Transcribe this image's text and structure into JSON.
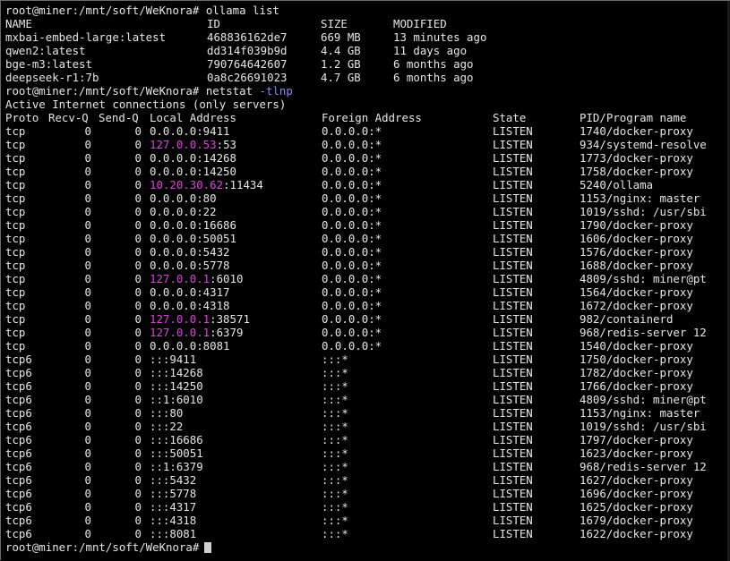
{
  "prompt": "root@miner:/mnt/soft/WeKnora#",
  "commands": {
    "ollama": "ollama list",
    "netstat_cmd": "netstat",
    "netstat_opt": "-tlnp"
  },
  "ollama": {
    "headers": [
      "NAME",
      "ID",
      "SIZE",
      "MODIFIED"
    ],
    "rows": [
      [
        "mxbai-embed-large:latest",
        "468836162de7",
        "669 MB",
        "13 minutes ago"
      ],
      [
        "qwen2:latest",
        "dd314f039b9d",
        "4.4 GB",
        "11 days ago"
      ],
      [
        "bge-m3:latest",
        "790764642607",
        "1.2 GB",
        "6 months ago"
      ],
      [
        "deepseek-r1:7b",
        "0a8c26691023",
        "4.7 GB",
        "6 months ago"
      ]
    ]
  },
  "netstat": {
    "banner": "Active Internet connections (only servers)",
    "headers": [
      "Proto",
      "Recv-Q",
      "Send-Q",
      "Local Address",
      "Foreign Address",
      "State",
      "PID/Program name"
    ],
    "rows": [
      [
        "tcp",
        "0",
        "0",
        "",
        "0.0.0.0:9411",
        "0.0.0.0:*",
        "LISTEN",
        "1740/docker-proxy"
      ],
      [
        "tcp",
        "0",
        "0",
        "127.0.0.53",
        ":53",
        "0.0.0.0:*",
        "LISTEN",
        "934/systemd-resolve"
      ],
      [
        "tcp",
        "0",
        "0",
        "",
        "0.0.0.0:14268",
        "0.0.0.0:*",
        "LISTEN",
        "1773/docker-proxy"
      ],
      [
        "tcp",
        "0",
        "0",
        "",
        "0.0.0.0:14250",
        "0.0.0.0:*",
        "LISTEN",
        "1758/docker-proxy"
      ],
      [
        "tcp",
        "0",
        "0",
        "10.20.30.62",
        ":11434",
        "0.0.0.0:*",
        "LISTEN",
        "5240/ollama"
      ],
      [
        "tcp",
        "0",
        "0",
        "",
        "0.0.0.0:80",
        "0.0.0.0:*",
        "LISTEN",
        "1153/nginx: master"
      ],
      [
        "tcp",
        "0",
        "0",
        "",
        "0.0.0.0:22",
        "0.0.0.0:*",
        "LISTEN",
        "1019/sshd: /usr/sbi"
      ],
      [
        "tcp",
        "0",
        "0",
        "",
        "0.0.0.0:16686",
        "0.0.0.0:*",
        "LISTEN",
        "1790/docker-proxy"
      ],
      [
        "tcp",
        "0",
        "0",
        "",
        "0.0.0.0:50051",
        "0.0.0.0:*",
        "LISTEN",
        "1606/docker-proxy"
      ],
      [
        "tcp",
        "0",
        "0",
        "",
        "0.0.0.0:5432",
        "0.0.0.0:*",
        "LISTEN",
        "1576/docker-proxy"
      ],
      [
        "tcp",
        "0",
        "0",
        "",
        "0.0.0.0:5778",
        "0.0.0.0:*",
        "LISTEN",
        "1688/docker-proxy"
      ],
      [
        "tcp",
        "0",
        "0",
        "127.0.0.1",
        ":6010",
        "0.0.0.0:*",
        "LISTEN",
        "4809/sshd: miner@pt"
      ],
      [
        "tcp",
        "0",
        "0",
        "",
        "0.0.0.0:4317",
        "0.0.0.0:*",
        "LISTEN",
        "1564/docker-proxy"
      ],
      [
        "tcp",
        "0",
        "0",
        "",
        "0.0.0.0:4318",
        "0.0.0.0:*",
        "LISTEN",
        "1672/docker-proxy"
      ],
      [
        "tcp",
        "0",
        "0",
        "127.0.0.1",
        ":38571",
        "0.0.0.0:*",
        "LISTEN",
        "982/containerd"
      ],
      [
        "tcp",
        "0",
        "0",
        "127.0.0.1",
        ":6379",
        "0.0.0.0:*",
        "LISTEN",
        "968/redis-server 12"
      ],
      [
        "tcp",
        "0",
        "0",
        "",
        "0.0.0.0:8081",
        "0.0.0.0:*",
        "LISTEN",
        "1540/docker-proxy"
      ],
      [
        "tcp6",
        "0",
        "0",
        "",
        ":::9411",
        ":::*",
        "LISTEN",
        "1750/docker-proxy"
      ],
      [
        "tcp6",
        "0",
        "0",
        "",
        ":::14268",
        ":::*",
        "LISTEN",
        "1782/docker-proxy"
      ],
      [
        "tcp6",
        "0",
        "0",
        "",
        ":::14250",
        ":::*",
        "LISTEN",
        "1766/docker-proxy"
      ],
      [
        "tcp6",
        "0",
        "0",
        "",
        "::1:6010",
        ":::*",
        "LISTEN",
        "4809/sshd: miner@pt"
      ],
      [
        "tcp6",
        "0",
        "0",
        "",
        ":::80",
        ":::*",
        "LISTEN",
        "1153/nginx: master"
      ],
      [
        "tcp6",
        "0",
        "0",
        "",
        ":::22",
        ":::*",
        "LISTEN",
        "1019/sshd: /usr/sbi"
      ],
      [
        "tcp6",
        "0",
        "0",
        "",
        ":::16686",
        ":::*",
        "LISTEN",
        "1797/docker-proxy"
      ],
      [
        "tcp6",
        "0",
        "0",
        "",
        ":::50051",
        ":::*",
        "LISTEN",
        "1623/docker-proxy"
      ],
      [
        "tcp6",
        "0",
        "0",
        "",
        "::1:6379",
        ":::*",
        "LISTEN",
        "968/redis-server 12"
      ],
      [
        "tcp6",
        "0",
        "0",
        "",
        ":::5432",
        ":::*",
        "LISTEN",
        "1627/docker-proxy"
      ],
      [
        "tcp6",
        "0",
        "0",
        "",
        ":::5778",
        ":::*",
        "LISTEN",
        "1696/docker-proxy"
      ],
      [
        "tcp6",
        "0",
        "0",
        "",
        ":::4317",
        ":::*",
        "LISTEN",
        "1625/docker-proxy"
      ],
      [
        "tcp6",
        "0",
        "0",
        "",
        ":::4318",
        ":::*",
        "LISTEN",
        "1679/docker-proxy"
      ],
      [
        "tcp6",
        "0",
        "0",
        "",
        ":::8081",
        ":::*",
        "LISTEN",
        "1622/docker-proxy"
      ]
    ]
  },
  "colors": {
    "background": "#000000",
    "text": "#e6e6e6",
    "highlight": "#e040e0",
    "option": "#8a8af0"
  }
}
